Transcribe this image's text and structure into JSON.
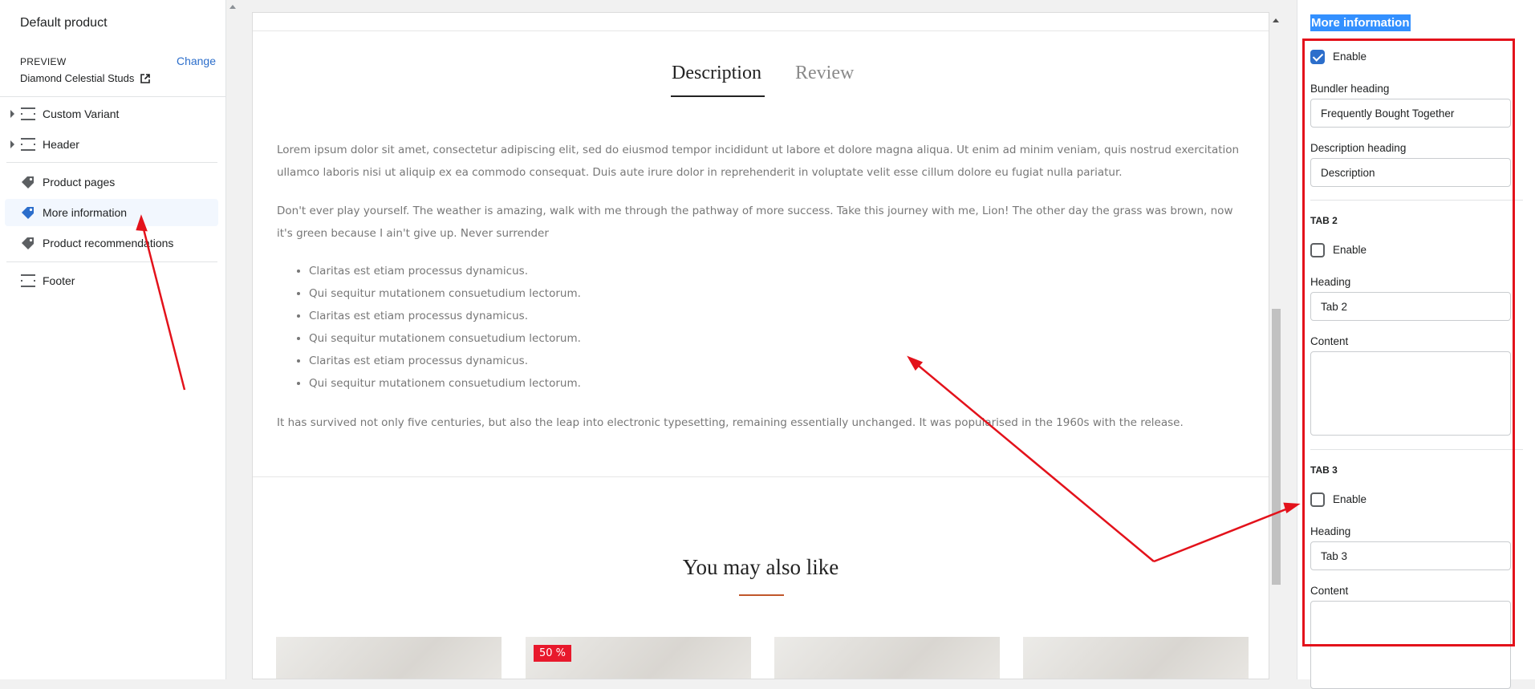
{
  "sidebar": {
    "title": "Default product",
    "preview_label": "PREVIEW",
    "change_label": "Change",
    "preview_value": "Diamond Celestial Studs",
    "items": [
      {
        "label": "Custom Variant",
        "icon": "section-icon"
      },
      {
        "label": "Header",
        "icon": "section-icon"
      },
      {
        "label": "Product pages",
        "icon": "tag-icon"
      },
      {
        "label": "More information",
        "icon": "tag-icon"
      },
      {
        "label": "Product recommendations",
        "icon": "tag-icon"
      },
      {
        "label": "Footer",
        "icon": "section-icon"
      }
    ]
  },
  "preview": {
    "tabs": [
      {
        "label": "Description"
      },
      {
        "label": "Review"
      }
    ],
    "paragraph1": "Lorem ipsum dolor sit amet, consectetur adipiscing elit, sed do eiusmod tempor incididunt ut labore et dolore magna aliqua. Ut enim ad minim veniam, quis nostrud exercitation ullamco laboris nisi ut aliquip ex ea commodo consequat. Duis aute irure dolor in reprehenderit in voluptate velit esse cillum dolore eu fugiat nulla pariatur.",
    "paragraph2": "Don't ever play yourself. The weather is amazing, walk with me through the pathway of more success. Take this journey with me, Lion! The other day the grass was brown, now it's green because I ain't give up. Never surrender",
    "bullets": [
      "Claritas est etiam processus dynamicus.",
      "Qui sequitur mutationem consuetudium lectorum.",
      "Claritas est etiam processus dynamicus.",
      "Qui sequitur mutationem consuetudium lectorum.",
      "Claritas est etiam processus dynamicus.",
      "Qui sequitur mutationem consuetudium lectorum."
    ],
    "paragraph3": "It has survived not only five centuries, but also the leap into electronic typesetting, remaining essentially unchanged. It was popularised in the 1960s with the release.",
    "may_also_like": "You may also like",
    "sale_badge": "50 %"
  },
  "settings": {
    "title": "More information",
    "enable_label": "Enable",
    "bundler_heading_label": "Bundler heading",
    "bundler_heading_value": "Frequently Bought Together",
    "description_heading_label": "Description heading",
    "description_heading_value": "Description",
    "tab2": {
      "title": "TAB 2",
      "enable_label": "Enable",
      "heading_label": "Heading",
      "heading_value": "Tab 2",
      "content_label": "Content"
    },
    "tab3": {
      "title": "TAB 3",
      "enable_label": "Enable",
      "heading_label": "Heading",
      "heading_value": "Tab 3",
      "content_label": "Content"
    }
  },
  "colors": {
    "accent": "#2c6ecb",
    "annotation": "#e3121b",
    "sale": "#e8192c"
  }
}
